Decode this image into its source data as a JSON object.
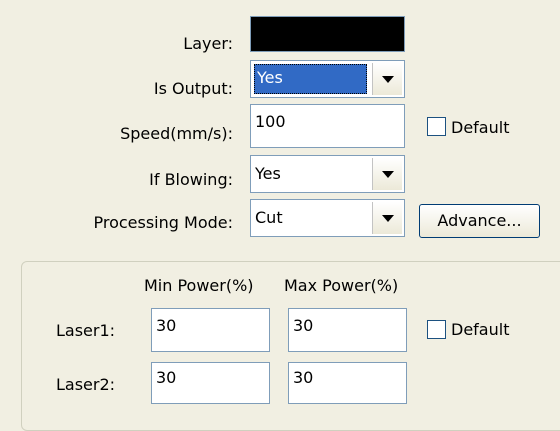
{
  "layer": {
    "label": "Layer:",
    "color": "#000000"
  },
  "is_output": {
    "label": "Is Output:",
    "value": "Yes"
  },
  "speed": {
    "label": "Speed(mm/s):",
    "value": "100",
    "default_label": "Default"
  },
  "if_blowing": {
    "label": "If Blowing:",
    "value": "Yes"
  },
  "processing_mode": {
    "label": "Processing Mode:",
    "value": "Cut",
    "advance_label": "Advance..."
  },
  "power": {
    "min_header": "Min Power(%)",
    "max_header": "Max Power(%)",
    "default_label": "Default",
    "lasers": [
      {
        "label": "Laser1:",
        "min": "30",
        "max": "30"
      },
      {
        "label": "Laser2:",
        "min": "30",
        "max": "30"
      }
    ]
  }
}
